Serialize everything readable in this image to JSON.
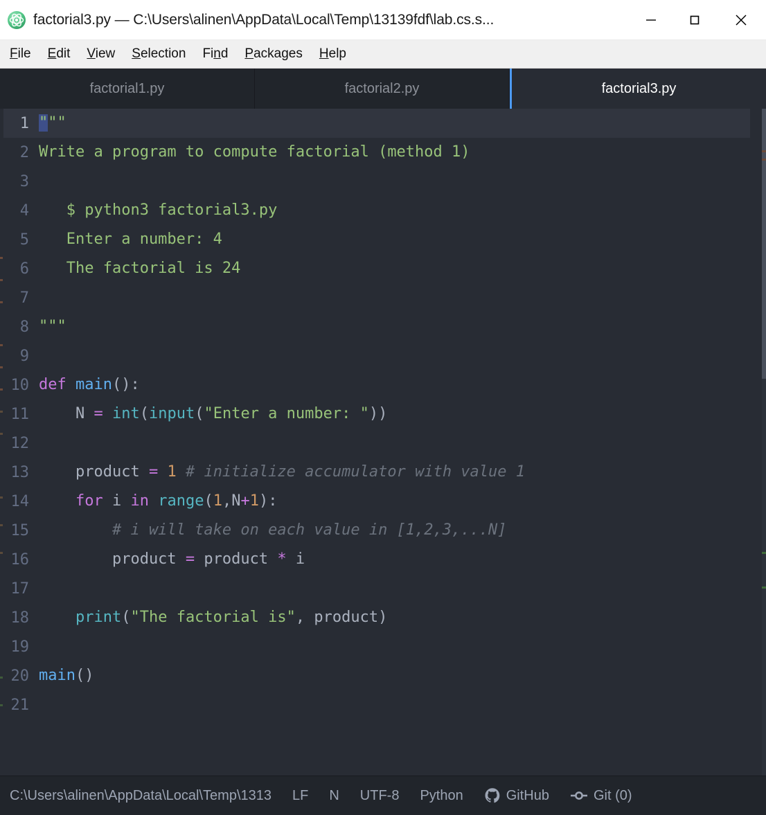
{
  "window": {
    "title": "factorial3.py — C:\\Users\\alinen\\AppData\\Local\\Temp\\13139fdf\\lab.cs.s...",
    "app_icon": "atom-logo-icon",
    "controls": {
      "minimize": "minimize-icon",
      "maximize": "maximize-icon",
      "close": "close-icon"
    },
    "accent_blue": "#4d9bf5",
    "editor_bg": "#282c34",
    "chrome_bg": "#21252b"
  },
  "menubar": {
    "items": [
      {
        "label": "File",
        "accel_index": 0
      },
      {
        "label": "Edit",
        "accel_index": 0
      },
      {
        "label": "View",
        "accel_index": 0
      },
      {
        "label": "Selection",
        "accel_index": 0
      },
      {
        "label": "Find",
        "accel_index": 2
      },
      {
        "label": "Packages",
        "accel_index": 0
      },
      {
        "label": "Help",
        "accel_index": 0
      }
    ]
  },
  "tabs": [
    {
      "label": "factorial1.py",
      "active": false
    },
    {
      "label": "factorial2.py",
      "active": false
    },
    {
      "label": "factorial3.py",
      "active": true
    }
  ],
  "editor": {
    "language": "Python",
    "cursor_line": 1,
    "selection": {
      "line": 1,
      "start_col": 0,
      "end_col": 1,
      "text": "\""
    },
    "line_numbers": [
      1,
      2,
      3,
      4,
      5,
      6,
      7,
      8,
      9,
      10,
      11,
      12,
      13,
      14,
      15,
      16,
      17,
      18,
      19,
      20,
      21
    ],
    "lines": [
      {
        "n": 1,
        "tokens": [
          {
            "t": "\"",
            "c": "t-str sel"
          },
          {
            "t": "\"\"",
            "c": "t-str"
          }
        ]
      },
      {
        "n": 2,
        "tokens": [
          {
            "t": "Write a program to compute factorial (method 1)",
            "c": "t-str"
          }
        ]
      },
      {
        "n": 3,
        "tokens": []
      },
      {
        "n": 4,
        "tokens": [
          {
            "t": "   $ python3 factorial3.py",
            "c": "t-str"
          }
        ]
      },
      {
        "n": 5,
        "tokens": [
          {
            "t": "   Enter a number: 4",
            "c": "t-str"
          }
        ]
      },
      {
        "n": 6,
        "tokens": [
          {
            "t": "   The factorial is 24",
            "c": "t-str"
          }
        ]
      },
      {
        "n": 7,
        "tokens": []
      },
      {
        "n": 8,
        "tokens": [
          {
            "t": "\"\"\"",
            "c": "t-str"
          }
        ]
      },
      {
        "n": 9,
        "tokens": []
      },
      {
        "n": 10,
        "tokens": [
          {
            "t": "def ",
            "c": "t-kw"
          },
          {
            "t": "main",
            "c": "t-fn"
          },
          {
            "t": "():",
            "c": "t-pun"
          }
        ]
      },
      {
        "n": 11,
        "tokens": [
          {
            "t": "    N ",
            "c": "t-var"
          },
          {
            "t": "=",
            "c": "t-op"
          },
          {
            "t": " ",
            "c": "t-pun"
          },
          {
            "t": "int",
            "c": "t-blt"
          },
          {
            "t": "(",
            "c": "t-pun"
          },
          {
            "t": "input",
            "c": "t-blt"
          },
          {
            "t": "(",
            "c": "t-pun"
          },
          {
            "t": "\"Enter a number: \"",
            "c": "t-str"
          },
          {
            "t": "))",
            "c": "t-pun"
          }
        ]
      },
      {
        "n": 12,
        "tokens": []
      },
      {
        "n": 13,
        "tokens": [
          {
            "t": "    product ",
            "c": "t-var"
          },
          {
            "t": "=",
            "c": "t-op"
          },
          {
            "t": " ",
            "c": "t-pun"
          },
          {
            "t": "1",
            "c": "t-num"
          },
          {
            "t": " ",
            "c": "t-pun"
          },
          {
            "t": "# initialize accumulator with value 1",
            "c": "t-com"
          }
        ]
      },
      {
        "n": 14,
        "tokens": [
          {
            "t": "    ",
            "c": "t-pun"
          },
          {
            "t": "for",
            "c": "t-kw"
          },
          {
            "t": " i ",
            "c": "t-var"
          },
          {
            "t": "in",
            "c": "t-kw"
          },
          {
            "t": " ",
            "c": "t-pun"
          },
          {
            "t": "range",
            "c": "t-blt"
          },
          {
            "t": "(",
            "c": "t-pun"
          },
          {
            "t": "1",
            "c": "t-num"
          },
          {
            "t": ",N",
            "c": "t-var"
          },
          {
            "t": "+",
            "c": "t-op"
          },
          {
            "t": "1",
            "c": "t-num"
          },
          {
            "t": "):",
            "c": "t-pun"
          }
        ]
      },
      {
        "n": 15,
        "tokens": [
          {
            "t": "        # i will take on each value in [1,2,3,...N]",
            "c": "t-com"
          }
        ]
      },
      {
        "n": 16,
        "tokens": [
          {
            "t": "        product ",
            "c": "t-var"
          },
          {
            "t": "=",
            "c": "t-op"
          },
          {
            "t": " product ",
            "c": "t-var"
          },
          {
            "t": "*",
            "c": "t-op"
          },
          {
            "t": " i",
            "c": "t-var"
          }
        ]
      },
      {
        "n": 17,
        "tokens": []
      },
      {
        "n": 18,
        "tokens": [
          {
            "t": "    ",
            "c": "t-pun"
          },
          {
            "t": "print",
            "c": "t-blt"
          },
          {
            "t": "(",
            "c": "t-pun"
          },
          {
            "t": "\"The factorial is\"",
            "c": "t-str"
          },
          {
            "t": ", product)",
            "c": "t-pun"
          }
        ]
      },
      {
        "n": 19,
        "tokens": []
      },
      {
        "n": 20,
        "tokens": [
          {
            "t": "main",
            "c": "t-fn"
          },
          {
            "t": "()",
            "c": "t-pun"
          }
        ]
      },
      {
        "n": 21,
        "tokens": []
      }
    ],
    "source_text": "\"\"\"\nWrite a program to compute factorial (method 1)\n\n   $ python3 factorial3.py\n   Enter a number: 4\n   The factorial is 24\n\n\"\"\"\n\ndef main():\n    N = int(input(\"Enter a number: \"))\n\n    product = 1 # initialize accumulator with value 1\n    for i in range(1,N+1):\n        # i will take on each value in [1,2,3,...N]\n        product = product * i\n\n    print(\"The factorial is\", product)\n\nmain()\n",
    "syntax_colors": {
      "string": "#98c379",
      "keyword": "#c678dd",
      "function": "#61afef",
      "builtin": "#56b6c2",
      "number": "#d19a66",
      "comment": "#6b727d",
      "text": "#abb2bf",
      "gutter": "#636d83",
      "selection": "#3e4f8a",
      "active_line": "#31353f"
    }
  },
  "statusbar": {
    "path": "C:\\Users\\alinen\\AppData\\Local\\Temp\\1313",
    "line_ending": "LF",
    "encoding_flag": "N",
    "encoding": "UTF-8",
    "grammar": "Python",
    "github": {
      "label": "GitHub",
      "icon": "github-octocat-icon"
    },
    "git": {
      "label": "Git (0)",
      "icon": "git-commit-icon"
    }
  }
}
